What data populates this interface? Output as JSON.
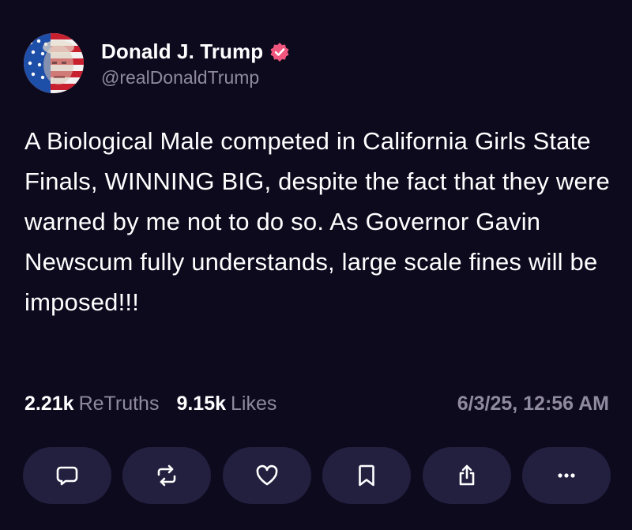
{
  "author": {
    "display_name": "Donald J. Trump",
    "handle": "@realDonaldTrump",
    "verified_icon": "verified-badge-icon",
    "avatar_icon": "avatar-image"
  },
  "post": {
    "text": "A Biological Male competed in California Girls State Finals, WINNING BIG, despite the fact that they were warned by me not to do so. As Governor Gavin Newscum fully understands, large scale fines will be imposed!!!"
  },
  "stats": {
    "retruths_count": "2.21k",
    "retruths_label": "ReTruths",
    "likes_count": "9.15k",
    "likes_label": "Likes",
    "timestamp": "6/3/25, 12:56 AM"
  },
  "actions": [
    {
      "icon": "reply-icon"
    },
    {
      "icon": "retruth-icon"
    },
    {
      "icon": "like-icon"
    },
    {
      "icon": "bookmark-icon"
    },
    {
      "icon": "share-icon"
    },
    {
      "icon": "more-icon"
    }
  ],
  "colors": {
    "background": "#0d0a1e",
    "button_background": "#231f3f",
    "muted_text": "#8f8a9f",
    "verified": "#f0567d"
  }
}
